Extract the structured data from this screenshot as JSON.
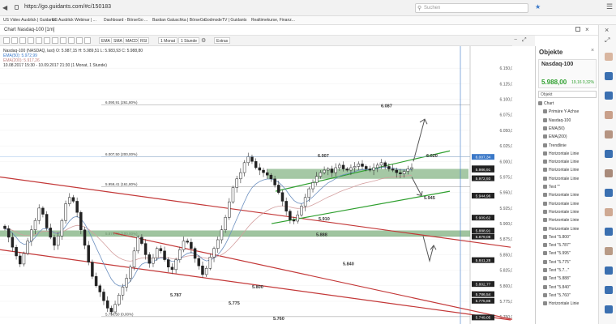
{
  "browser": {
    "url": "https://go.guidants.com/#c/150183",
    "search_placeholder": "Suchen"
  },
  "bookmarks": [
    "US Video Ausblick | Guidants",
    "US Ausblick Webinar | ...",
    "Dashboard - BörseGo ...",
    "Bastian Galuschka | BörseGo",
    "GodmodeTV | Guidants",
    "Realtimekurse, Finanz..."
  ],
  "window": {
    "title": "Chart Nasdaq-100 [1m]"
  },
  "toolbar": {
    "items": [
      "EMA",
      "SMA",
      "MACD",
      "RSI",
      "1 Monat",
      "1 Stunde",
      "Extras"
    ]
  },
  "chart_header": {
    "line1": "Nasdaq-100 (NASDAQ, last)   O: 5.987,15  H: 5.989,51  L: 5.983,93  C: 5.988,80",
    "line2": "EMA(50): 5.972,99",
    "line3": "EMA(200): 5.917,26",
    "line4": "10.08.2017 15:30 - 10.09.2017 21:30  (1 Monat, 1 Stunde)"
  },
  "chart_data": {
    "type": "candlestick",
    "ylim": [
      5745,
      6175
    ],
    "y_ticks": [
      "6.150,00",
      "6.125,00",
      "6.100,00",
      "6.075,00",
      "6.050,00",
      "6.025,00",
      "6.000,00",
      "5.975,00",
      "5.950,00",
      "5.925,00",
      "5.900,00",
      "5.875,00",
      "5.850,00",
      "5.825,00",
      "5.800,00",
      "5.775,00",
      "5.750,00"
    ],
    "y_tick_values": [
      6150,
      6125,
      6100,
      6075,
      6050,
      6025,
      6000,
      5975,
      5950,
      5925,
      5900,
      5875,
      5850,
      5825,
      5800,
      5775,
      5750
    ],
    "price_tags": [
      {
        "label": "6.007,34",
        "value": 6007.34,
        "color": "#3a78c8"
      },
      {
        "label": "5.988,91",
        "value": 5988.91,
        "color": "#222"
      },
      {
        "label": "5.986,91",
        "value": 5986.91,
        "color": "#222"
      },
      {
        "label": "5.972,93",
        "value": 5972.93,
        "color": "#222"
      },
      {
        "label": "5.944,96",
        "value": 5944.96,
        "color": "#222"
      },
      {
        "label": "5.909,62",
        "value": 5909.62,
        "color": "#222"
      },
      {
        "label": "5.888,91",
        "value": 5888.91,
        "color": "#222"
      },
      {
        "label": "5.879,08",
        "value": 5879.08,
        "color": "#222"
      },
      {
        "label": "5.841,28",
        "value": 5841.28,
        "color": "#222"
      },
      {
        "label": "5.802,77",
        "value": 5802.77,
        "color": "#222"
      },
      {
        "label": "5.786,54",
        "value": 5786.54,
        "color": "#222"
      },
      {
        "label": "5.775,88",
        "value": 5775.88,
        "color": "#222"
      },
      {
        "label": "5.749,05",
        "value": 5749.05,
        "color": "#222"
      }
    ],
    "fib_levels": [
      {
        "label": "6.090,91 (261,80%)",
        "value": 6090.91
      },
      {
        "label": "6.007,50 (200,00%)",
        "value": 6007.5
      },
      {
        "label": "5.959,41 (161,80%)",
        "value": 5959.41
      },
      {
        "label": "5.879,80 (100,00%)",
        "value": 5879.8
      },
      {
        "label": "5.750,50 (0,00%)",
        "value": 5750.5
      }
    ],
    "annotations": [
      {
        "text": "6.087",
        "value": 6087
      },
      {
        "text": "6.007",
        "value": 6007
      },
      {
        "text": "6.020",
        "value": 6007
      },
      {
        "text": "5.945",
        "value": 5939
      },
      {
        "text": "5.910",
        "value": 5905
      },
      {
        "text": "5.888",
        "value": 5880
      },
      {
        "text": "5.840",
        "value": 5833
      },
      {
        "text": "5.800",
        "value": 5796
      },
      {
        "text": "5.787",
        "value": 5783
      },
      {
        "text": "5.775",
        "value": 5770
      },
      {
        "text": "5.760",
        "value": 5745
      }
    ],
    "candles_close": [
      5892,
      5878,
      5862,
      5848,
      5835,
      5852,
      5872,
      5890,
      5905,
      5925,
      5915,
      5893,
      5878,
      5865,
      5880,
      5905,
      5932,
      5942,
      5936,
      5918,
      5890,
      5865,
      5838,
      5815,
      5800,
      5790,
      5776,
      5764,
      5758,
      5770,
      5785,
      5798,
      5812,
      5830,
      5856,
      5878,
      5868,
      5850,
      5836,
      5845,
      5860,
      5856,
      5842,
      5830,
      5826,
      5842,
      5858,
      5872,
      5870,
      5860,
      5844,
      5832,
      5818,
      5828,
      5846,
      5860,
      5874,
      5890,
      5910,
      5935,
      5958,
      5972,
      5982,
      5998,
      6008,
      6000,
      5990,
      5986,
      5982,
      5978,
      5972,
      5962,
      5950,
      5936,
      5920,
      5906,
      5904,
      5914,
      5928,
      5942,
      5956,
      5966,
      5976,
      5982,
      5986,
      5988,
      5982,
      5990,
      5994,
      5988,
      5986,
      5990,
      5992,
      5996,
      5992,
      5988,
      5986,
      5990,
      5994,
      5998,
      5992,
      5988,
      5986,
      5982,
      5980,
      5984,
      5988,
      5990
    ]
  },
  "sidebar": {
    "title": "Objekte",
    "instrument": "Nasdaq-100",
    "price": "5.988,00",
    "change": "19,16  0,32%",
    "objekt_label": "Objekt",
    "tree": [
      "Chart",
      "Primäre Y-Achse",
      "Nasdaq-100",
      "EMA(50)",
      "EMA(200)",
      "Trendlinie",
      "Horizontale Linie",
      "Horizontale Linie",
      "Horizontale Linie",
      "Horizontale Linie",
      "Text \"\"",
      "Horizontale Linie",
      "Horizontale Linie",
      "Horizontale Linie",
      "Horizontale Linie",
      "Horizontale Linie",
      "Text \"5.800\"",
      "Text \"5.787\"",
      "Text \"5.995\"",
      "Text \"5.775\"",
      "Text \"5.7...\"",
      "Text \"5.888\"",
      "Text \"5.840\"",
      "Text \"5.760\"",
      "Horizontale Linie"
    ]
  },
  "colors": {
    "accent": "#3a78c8",
    "green_zone": "#7fb07f",
    "red_line": "#c33838",
    "up": "#2e9f2e"
  }
}
